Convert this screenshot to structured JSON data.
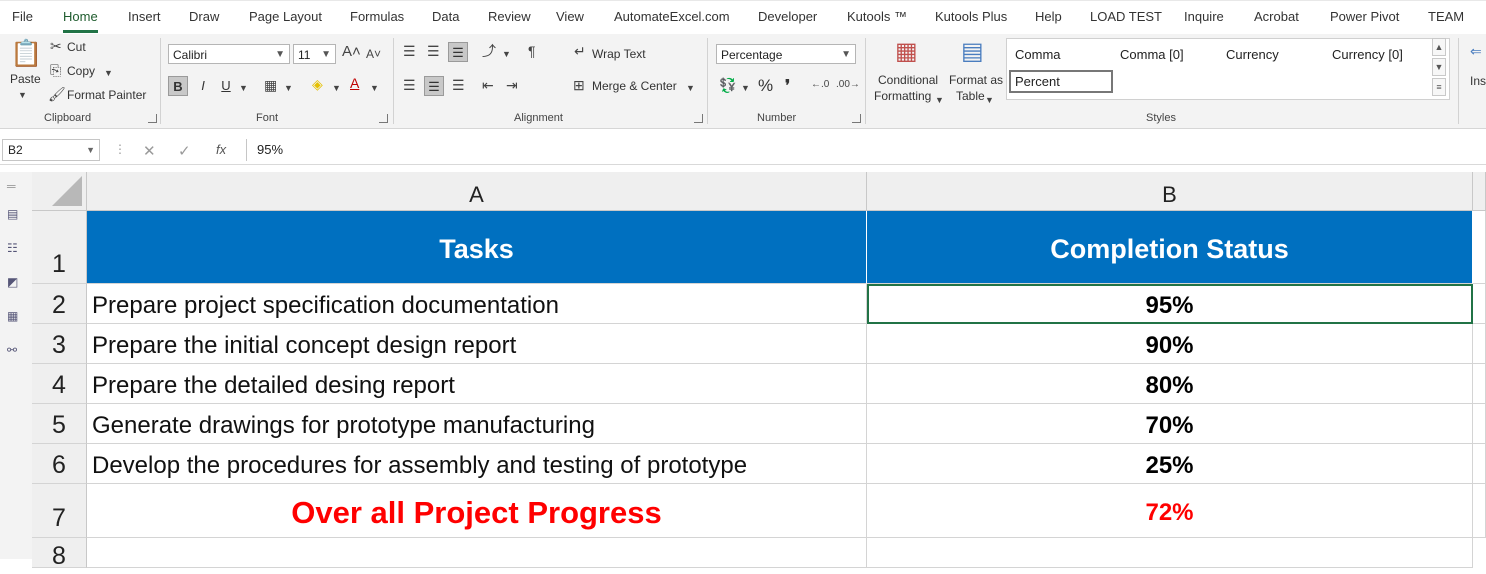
{
  "tabs": [
    "File",
    "Home",
    "Insert",
    "Draw",
    "Page Layout",
    "Formulas",
    "Data",
    "Review",
    "View",
    "AutomateExcel.com",
    "Developer",
    "Kutools ™",
    "Kutools Plus",
    "Help",
    "LOAD TEST",
    "Inquire",
    "Acrobat",
    "Power Pivot",
    "TEAM"
  ],
  "active_tab": "Home",
  "ribbon": {
    "clipboard": {
      "paste": "Paste",
      "cut": "Cut",
      "copy": "Copy",
      "format_painter": "Format Painter",
      "label": "Clipboard"
    },
    "font": {
      "name": "Calibri",
      "size": "11",
      "label": "Font",
      "bold": "B",
      "italic": "I",
      "underline": "U"
    },
    "alignment": {
      "wrap": "Wrap Text",
      "merge": "Merge & Center",
      "label": "Alignment"
    },
    "number": {
      "format": "Percentage",
      "percent_sym": "%",
      "comma_sym": "❜",
      "label": "Number"
    },
    "styles": {
      "conditional": "Conditional",
      "conditional2": "Formatting",
      "format_as": "Format as",
      "format_as2": "Table",
      "gallery": [
        "Comma",
        "Comma [0]",
        "Currency",
        "Currency [0]",
        "Percent"
      ],
      "label": "Styles"
    },
    "insert_partial": "Ins"
  },
  "formula_bar": {
    "name_box": "B2",
    "fx": "fx",
    "value": "95%"
  },
  "sheet": {
    "columns": [
      "A",
      "B"
    ],
    "rows": [
      "1",
      "2",
      "3",
      "4",
      "5",
      "6",
      "7",
      "8"
    ],
    "header": {
      "task": "Tasks",
      "status": "Completion Status"
    },
    "tasks": [
      {
        "task": "Prepare project specification documentation",
        "status": "95%"
      },
      {
        "task": "Prepare the initial concept design report",
        "status": "90%"
      },
      {
        "task": "Prepare the detailed desing report",
        "status": "80%"
      },
      {
        "task": "Generate drawings for prototype manufacturing",
        "status": "70%"
      },
      {
        "task": "Develop the procedures for assembly and testing of prototype",
        "status": "25%"
      }
    ],
    "total": {
      "label": "Over all Project Progress",
      "value": "72%"
    }
  },
  "colors": {
    "header_fill": "#0070c0",
    "accent": "#217346",
    "total_text": "#ff0000"
  }
}
